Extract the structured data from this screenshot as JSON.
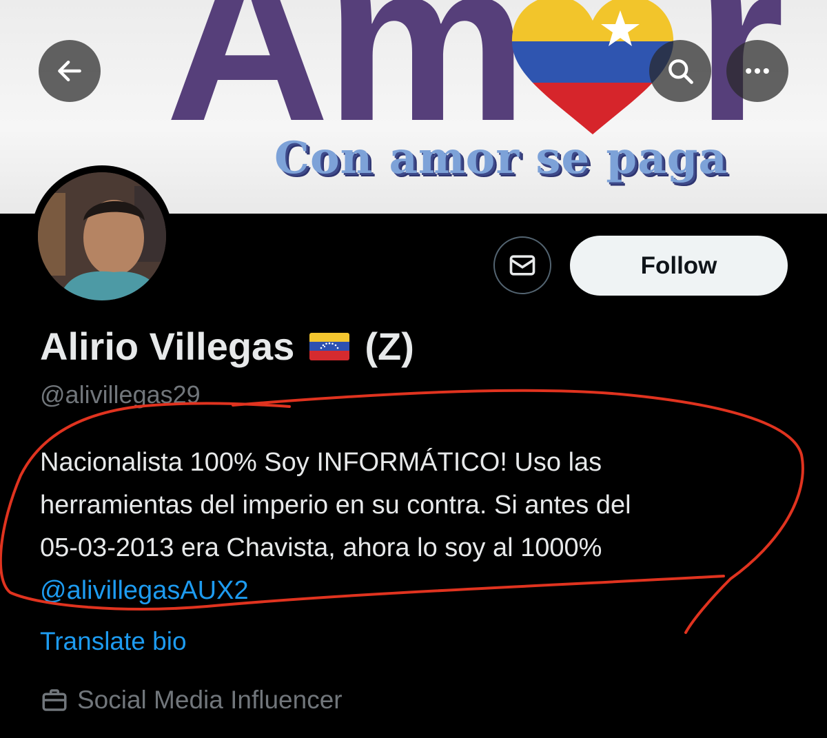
{
  "banner": {
    "word": "Am",
    "word_end": "r",
    "tagline": "Con amor se paga"
  },
  "icons": {
    "back": "arrow-left-icon",
    "search": "search-icon",
    "more": "more-horizontal-icon",
    "message": "envelope-icon",
    "job": "briefcase-icon",
    "flag": "venezuela-flag-icon"
  },
  "profile": {
    "display_name": "Alirio Villegas",
    "name_suffix": "(Z)",
    "handle": "@alivillegas29",
    "follow_label": "Follow",
    "bio_lines": [
      "Nacionalista 100% Soy INFORMÁTICO! Uso las",
      "herramientas del imperio en su contra. Si antes del",
      "05-03-2013 era Chavista, ahora lo soy al 1000%"
    ],
    "bio_mention": "@alivillegasAUX2",
    "translate_label": "Translate bio",
    "job": "Social Media Influencer"
  },
  "colors": {
    "background": "#000000",
    "text_primary": "#e7e9ea",
    "text_secondary": "#71767b",
    "link": "#1d9bf0",
    "follow_bg": "#eff3f4",
    "annotation": "#e0331f",
    "banner_purple": "#563f7a"
  }
}
